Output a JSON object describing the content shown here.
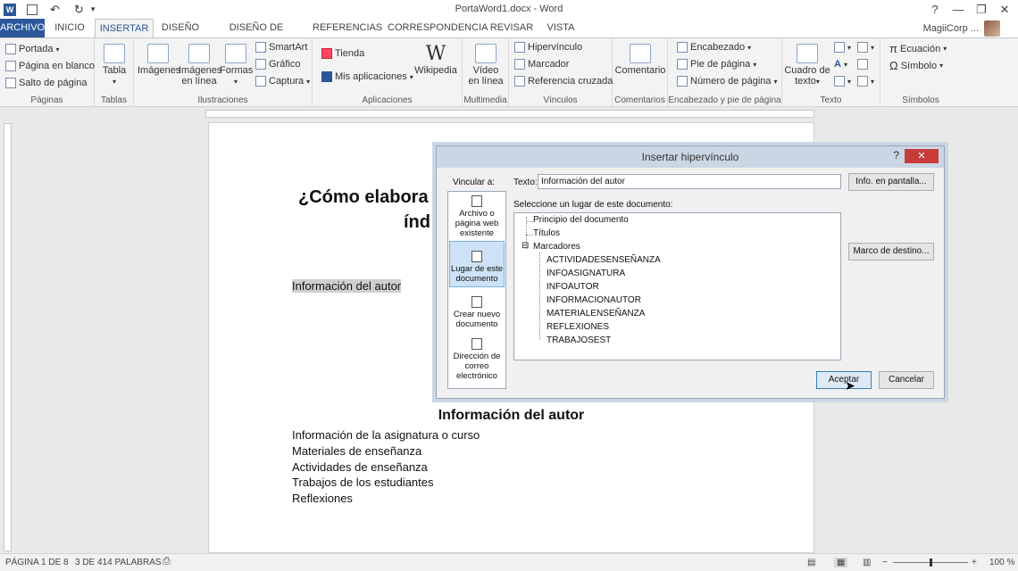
{
  "titlebar": {
    "title": "PortaWord1.docx - Word",
    "help": "?",
    "minimize": "—",
    "restore": "❐",
    "close": "✕"
  },
  "tabs": [
    "ARCHIVO",
    "INICIO",
    "INSERTAR",
    "DISEÑO",
    "DISEÑO DE PÁGINA",
    "REFERENCIAS",
    "CORRESPONDENCIA",
    "REVISAR",
    "VISTA"
  ],
  "active_tab": "INSERTAR",
  "user": "MagiiCorp ...",
  "ribbon": {
    "paginas": {
      "label": "Páginas",
      "items": [
        "Portada",
        "Página en blanco",
        "Salto de página"
      ]
    },
    "tablas": {
      "label": "Tablas",
      "item": "Tabla"
    },
    "ilustraciones": {
      "label": "Ilustraciones",
      "imagenes": "Imágenes",
      "imagenes_linea_1": "Imágenes",
      "imagenes_linea_2": "en línea",
      "formas": "Formas",
      "smartart": "SmartArt",
      "grafico": "Gráfico",
      "captura": "Captura"
    },
    "aplicaciones": {
      "label": "Aplicaciones",
      "tienda": "Tienda",
      "mis_aplicaciones": "Mis aplicaciones",
      "wikipedia": "Wikipedia"
    },
    "multimedia": {
      "label": "Multimedia",
      "video_1": "Vídeo",
      "video_2": "en línea"
    },
    "vinculos": {
      "label": "Vínculos",
      "items": [
        "Hipervínculo",
        "Marcador",
        "Referencia cruzada"
      ]
    },
    "comentarios": {
      "label": "Comentarios",
      "item": "Comentario"
    },
    "encabezado": {
      "label": "Encabezado y pie de página",
      "items": [
        "Encabezado",
        "Pie de página",
        "Número de página"
      ]
    },
    "texto": {
      "label": "Texto",
      "cuadro_1": "Cuadro de",
      "cuadro_2": "texto"
    },
    "simbolos": {
      "label": "Símbolos",
      "ecuacion": "Ecuación",
      "simbolo": "Símbolo"
    }
  },
  "document": {
    "heading_line1": "¿Cómo elabora",
    "heading_line2": "índ",
    "selected_text": "Información del autor",
    "section_heading": "Información del autor",
    "lines": [
      "Información de la asignatura o curso",
      "Materiales de enseñanza",
      "Actividades de enseñanza",
      "Trabajos de los estudiantes",
      "Reflexiones"
    ]
  },
  "dialog": {
    "title": "Insertar hipervínculo",
    "help": "?",
    "close": "✕",
    "vincular_label": "Vincular a:",
    "texto_label": "Texto:",
    "texto_value": "Información del autor",
    "info_button": "Info. en pantalla...",
    "select_label": "Seleccione un lugar de este documento:",
    "marco_button": "Marco de destino...",
    "link_options": [
      {
        "line1": "Archivo o",
        "line2": "página web",
        "line3": "existente"
      },
      {
        "line1": "Lugar de este",
        "line2": "documento",
        "line3": ""
      },
      {
        "line1": "Crear nuevo",
        "line2": "documento",
        "line3": ""
      },
      {
        "line1": "Dirección de",
        "line2": "correo",
        "line3": "electrónico"
      }
    ],
    "tree": {
      "principio": "Principio del documento",
      "titulos": "Títulos",
      "marcadores": "Marcadores",
      "expander": "⊟",
      "bookmarks": [
        "ACTIVIDADESENSEÑANZA",
        "INFOASIGNATURA",
        "INFOAUTOR",
        "INFORMACIONAUTOR",
        "MATERIALENSEÑANZA",
        "REFLEXIONES",
        "TRABAJOSEST"
      ]
    },
    "aceptar": "Aceptar",
    "cancelar": "Cancelar"
  },
  "status": {
    "page": "PÁGINA 1 DE 8",
    "words": "3 DE 414 PALABRAS",
    "zoom": "100 %"
  },
  "colors": {
    "accent": "#2b579a",
    "close_red": "#c73b3b",
    "selection": "#cde2f6"
  }
}
